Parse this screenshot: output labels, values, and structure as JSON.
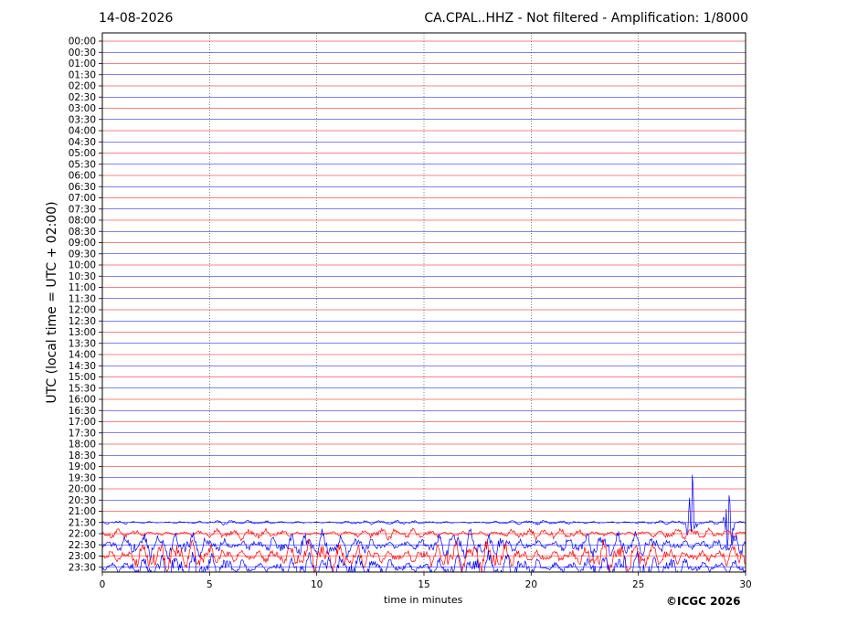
{
  "header": {
    "date": "14-08-2026",
    "title": "CA.CPAL..HHZ - Not filtered - Amplification: 1/8000"
  },
  "footer": {
    "copyright": "©ICGC 2026"
  },
  "chart_data": {
    "type": "line",
    "xlabel": "time in minutes",
    "ylabel": "UTC (local time = UTC + 02:00)",
    "xlim": [
      0,
      30
    ],
    "xticks": [
      0,
      5,
      10,
      15,
      20,
      25,
      30
    ],
    "grid": "vertical dotted lines at every 5 minutes",
    "row_labels": [
      "00:00",
      "00:30",
      "01:00",
      "01:30",
      "02:00",
      "02:30",
      "03:00",
      "03:30",
      "04:00",
      "04:30",
      "05:00",
      "05:30",
      "06:00",
      "06:30",
      "07:00",
      "07:30",
      "08:00",
      "08:30",
      "09:00",
      "09:30",
      "10:00",
      "10:30",
      "11:00",
      "11:30",
      "12:00",
      "12:30",
      "13:00",
      "13:30",
      "14:00",
      "14:30",
      "15:00",
      "15:30",
      "16:00",
      "16:30",
      "17:00",
      "17:30",
      "18:00",
      "18:30",
      "19:00",
      "19:30",
      "20:00",
      "20:30",
      "21:00",
      "21:30",
      "22:00",
      "22:30",
      "23:00",
      "23:30"
    ],
    "colors": {
      "even_rows": "#ff0000",
      "odd_rows": "#0000ff",
      "axis": "#000000"
    },
    "active_traces": [
      {
        "row": "21:30",
        "color": "#0000ff",
        "amplitude_rows": 0.2,
        "event_spikes_minutes": [
          27.5,
          29.2
        ]
      },
      {
        "row": "22:00",
        "color": "#ff0000",
        "amplitude_rows": 0.5
      },
      {
        "row": "22:30",
        "color": "#0000ff",
        "amplitude_rows": 1.2
      },
      {
        "row": "23:00",
        "color": "#ff0000",
        "amplitude_rows": 1.4
      },
      {
        "row": "23:30",
        "color": "#0000ff",
        "amplitude_rows": 1.4
      }
    ]
  }
}
